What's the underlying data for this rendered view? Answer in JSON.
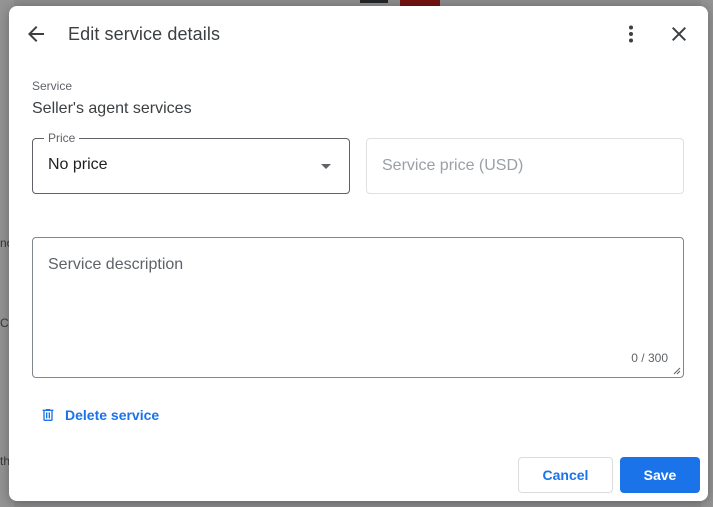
{
  "background": {
    "fragments": [
      "no",
      "Ca",
      "th"
    ]
  },
  "header": {
    "title": "Edit service details",
    "icons": {
      "back": "arrow-back-icon",
      "more": "more-vert-icon",
      "close": "close-icon"
    }
  },
  "service": {
    "label": "Service",
    "name": "Seller's agent services"
  },
  "price": {
    "legend": "Price",
    "selected": "No price"
  },
  "amount": {
    "placeholder": "Service price (USD)"
  },
  "description": {
    "placeholder": "Service description",
    "counter": "0 / 300"
  },
  "delete": {
    "label": "Delete service",
    "icon": "trash-icon"
  },
  "actions": {
    "cancel_label": "Cancel",
    "save_label": "Save"
  },
  "colors": {
    "accent": "#1a73e8",
    "text": "#202124",
    "secondary_text": "#5f6368"
  }
}
